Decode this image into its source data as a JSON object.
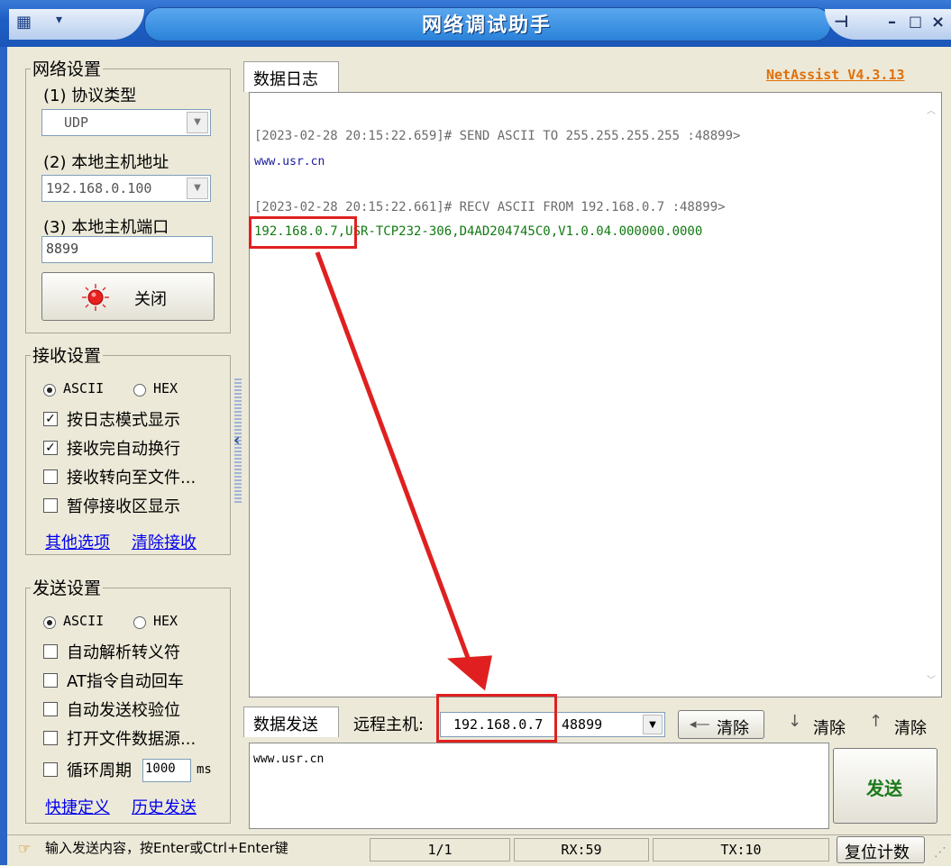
{
  "window": {
    "title": "网络调试助手",
    "brand": "NetAssist V4.3.13"
  },
  "network_settings": {
    "group_label": "网络设置",
    "protocol_label": "(1) 协议类型",
    "protocol_value": "UDP",
    "local_ip_label": "(2) 本地主机地址",
    "local_ip_value": "192.168.0.100",
    "local_port_label": "(3) 本地主机端口",
    "local_port_value": "8899",
    "connect_button": "关闭"
  },
  "receive_settings": {
    "group_label": "接收设置",
    "radio_ascii": "ASCII",
    "radio_hex": "HEX",
    "checks": [
      "按日志模式显示",
      "接收完自动换行",
      "接收转向至文件...",
      "暂停接收区显示"
    ],
    "checked": [
      true,
      true,
      false,
      false
    ],
    "link_more": "其他选项",
    "link_clear": "清除接收"
  },
  "send_settings": {
    "group_label": "发送设置",
    "radio_ascii": "ASCII",
    "radio_hex": "HEX",
    "checks": [
      "自动解析转义符",
      "AT指令自动回车",
      "自动发送校验位",
      "打开文件数据源..."
    ],
    "loop_label": "循环周期",
    "loop_value": "1000",
    "loop_unit": "ms",
    "link_shortcut": "快捷定义",
    "link_history": "历史发送"
  },
  "log": {
    "tab_label": "数据日志",
    "lines": [
      {
        "text": "[2023-02-28 20:15:22.659]# SEND ASCII TO 255.255.255.255 :48899>",
        "color": "#6b6b6b"
      },
      {
        "text": "www.usr.cn",
        "color": "#1a1aa0"
      },
      {
        "text": "[2023-02-28 20:15:22.661]# RECV ASCII FROM 192.168.0.7 :48899>",
        "color": "#6b6b6b"
      },
      {
        "text": "192.168.0.7,USR-TCP232-306,D4AD204745C0,V1.0.04.000000.0000",
        "color": "#107a10"
      }
    ]
  },
  "send_bar": {
    "tab_label": "数据发送",
    "remote_label": "远程主机:",
    "remote_ip": "192.168.0.7",
    "remote_port": "48899",
    "clear_btn_1": "清除",
    "clear_btn_2": "清除",
    "clear_btn_3": "清除",
    "message": "www.usr.cn",
    "send_button": "发送"
  },
  "status": {
    "hint": "输入发送内容，按Enter或Ctrl+Enter键",
    "page": "1/1",
    "rx": "RX:59",
    "tx": "TX:10",
    "reset": "复位计数"
  },
  "colors": {
    "title_bar": "#1f5fc4",
    "annotation": "#e02020",
    "recv_text": "#107a10",
    "brand": "#e0700a"
  }
}
